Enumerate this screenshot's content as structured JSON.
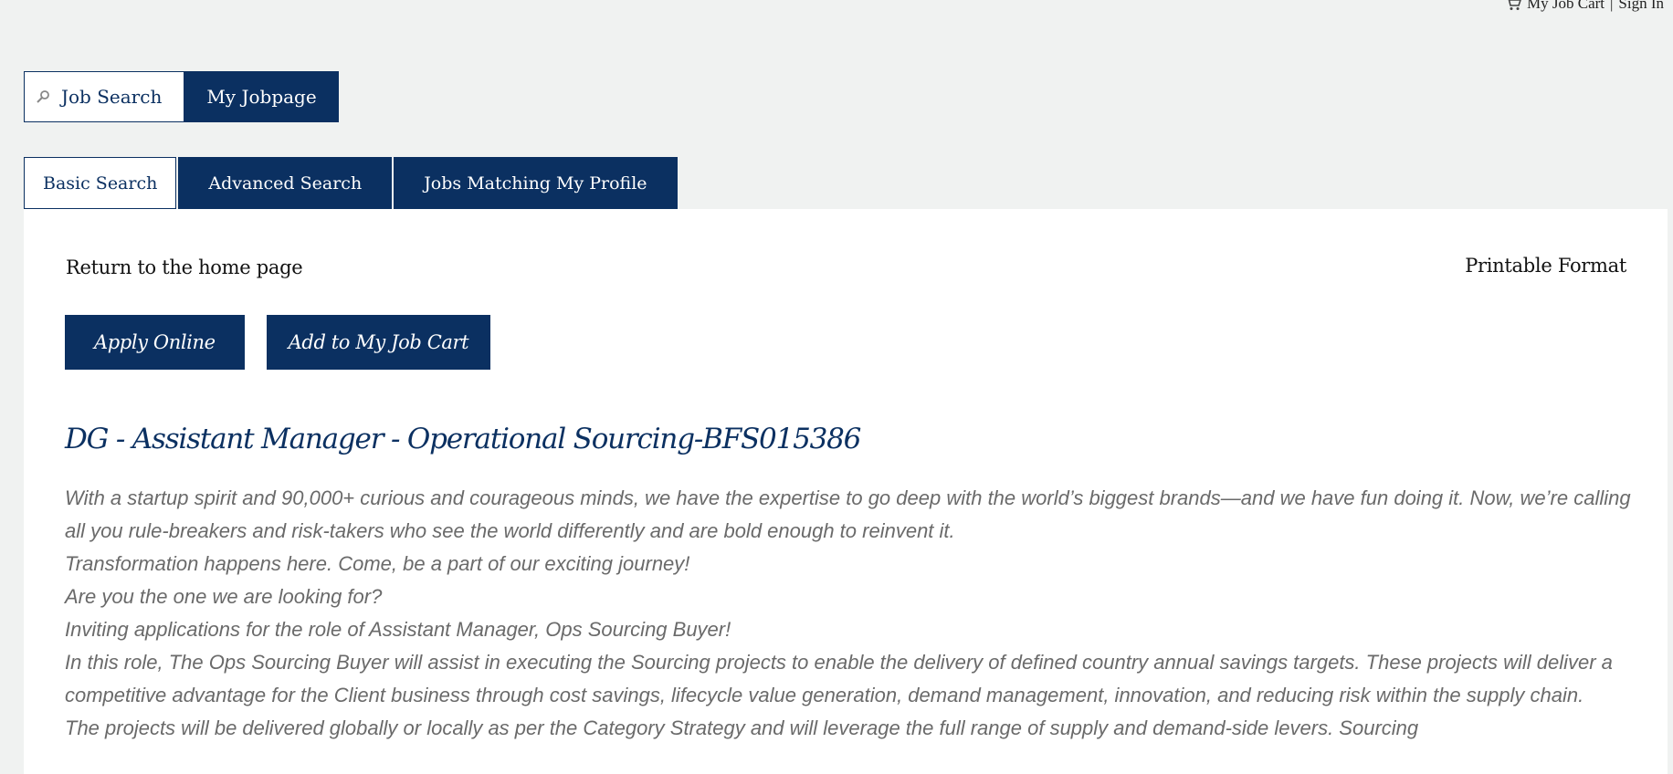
{
  "topbar": {
    "cart_label": "My Job Cart",
    "separator": "|",
    "signin_label": "Sign In"
  },
  "main_tabs": {
    "job_search": "Job Search",
    "my_jobpage": "My Jobpage"
  },
  "sub_tabs": {
    "basic": "Basic Search",
    "advanced": "Advanced Search",
    "matching": "Jobs Matching My Profile"
  },
  "content": {
    "return_link": "Return to the home page",
    "printable": "Printable Format",
    "apply_button": "Apply Online",
    "add_cart_button": "Add to My Job Cart",
    "job_title": "DG - Assistant Manager - Operational Sourcing-BFS015386",
    "paragraphs": [
      "With a startup spirit and 90,000+ curious and courageous minds, we have the expertise to go deep with the world’s biggest brands—and we have fun doing it. Now, we’re calling all you rule-breakers and risk-takers who see the world differently and are bold enough to reinvent it.",
      "Transformation happens here. Come, be a part of our exciting journey!",
      "Are you the one we are looking for?",
      "Inviting applications for the role of Assistant Manager, Ops Sourcing Buyer!",
      "In this role, The Ops Sourcing Buyer will assist in executing the Sourcing projects to enable the delivery of defined country annual savings targets. These projects will deliver a competitive advantage for the Client business through cost savings, lifecycle value generation, demand management, innovation, and reducing risk within the supply chain.",
      "The projects will be delivered globally or locally as per the Category Strategy and will leverage the full range of supply and demand-side levers. Sourcing"
    ]
  },
  "colors": {
    "brand": "#0b3061",
    "page_bg": "#f0f2f1",
    "body_text": "#6a6a6a"
  },
  "icons": [
    "cart-icon",
    "search-icon"
  ]
}
